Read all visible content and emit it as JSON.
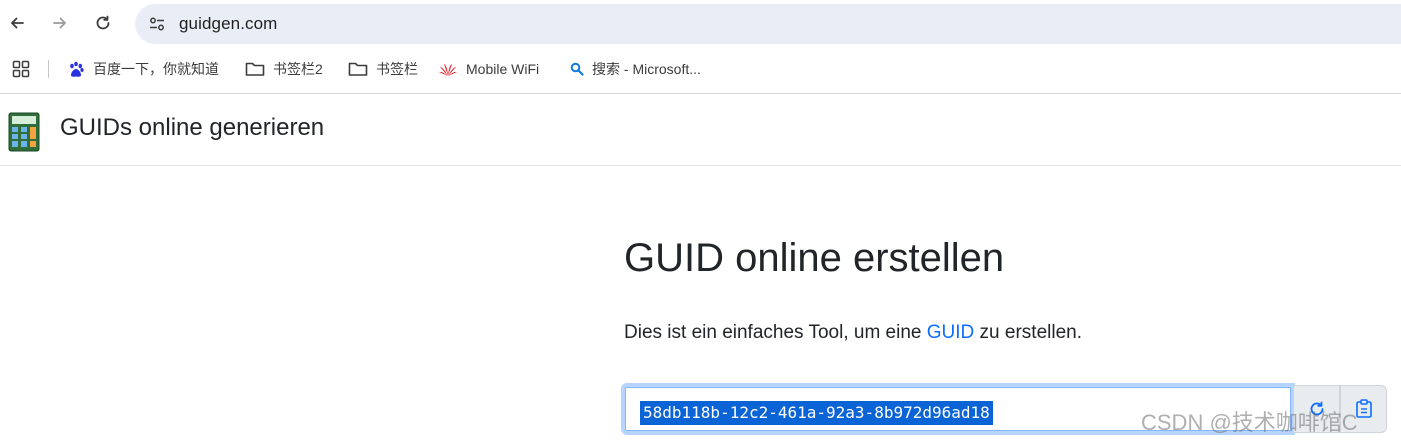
{
  "browser": {
    "url": "guidgen.com",
    "bookmarks": [
      {
        "label": "百度一下，你就知道",
        "icon": "baidu-paw-icon"
      },
      {
        "label": "书签栏2",
        "icon": "folder-icon"
      },
      {
        "label": "书签栏",
        "icon": "folder-icon"
      },
      {
        "label": "Mobile WiFi",
        "icon": "huawei-icon"
      },
      {
        "label": "搜索 - Microsoft...",
        "icon": "bing-search-icon"
      }
    ]
  },
  "app": {
    "title": "GUIDs online generieren"
  },
  "main": {
    "heading": "GUID online erstellen",
    "desc_before": "Dies ist ein einfaches Tool, um eine ",
    "desc_link": "GUID",
    "desc_after": " zu erstellen.",
    "guid_value": "58db118b-12c2-461a-92a3-8b972d96ad18"
  },
  "watermark": "CSDN @技术咖啡馆C",
  "colors": {
    "link": "#0d6efd",
    "selection": "#0a64d6",
    "omnibox": "#e9eef6",
    "focus_ring": "#b6d4fe"
  }
}
